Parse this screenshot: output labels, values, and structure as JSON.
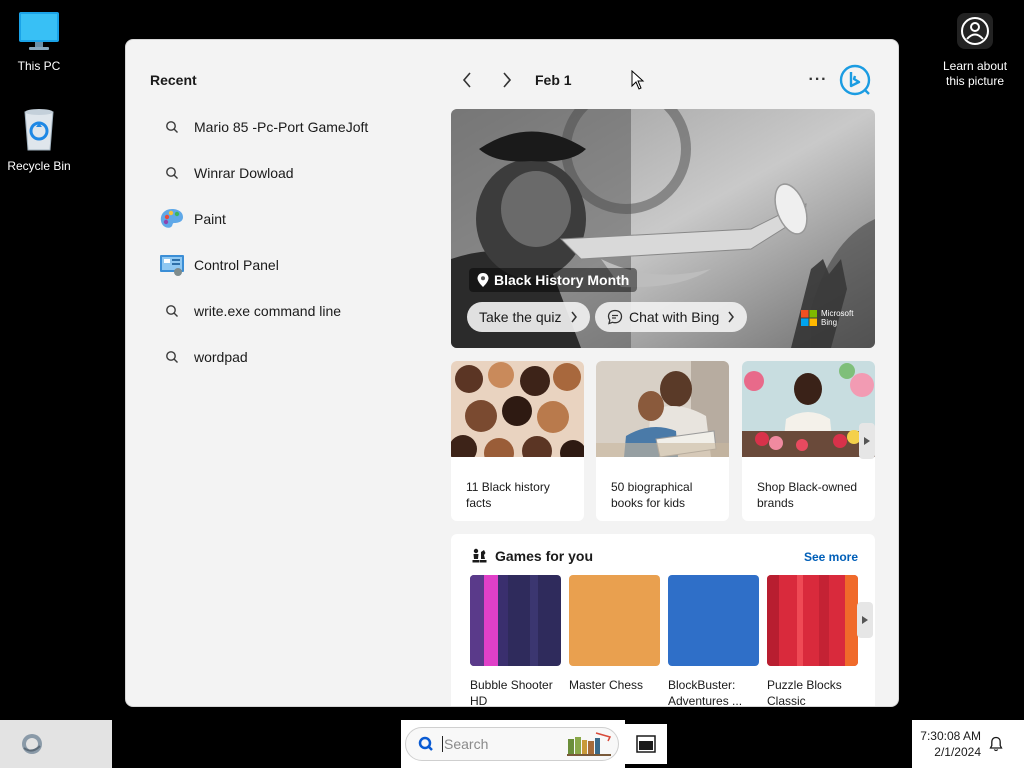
{
  "desktop": {
    "this_pc": "This PC",
    "recycle_bin": "Recycle Bin",
    "learn_line1": "Learn about",
    "learn_line2": "this picture"
  },
  "panel": {
    "recent_title": "Recent",
    "recent": [
      {
        "label": "Mario 85 -Pc-Port GameJoft",
        "icon": "search-icon"
      },
      {
        "label": "Winrar Dowload",
        "icon": "search-icon"
      },
      {
        "label": "Paint",
        "icon": "paint-icon"
      },
      {
        "label": "Control Panel",
        "icon": "control-panel-icon"
      },
      {
        "label": "write.exe command line",
        "icon": "search-icon"
      },
      {
        "label": "wordpad",
        "icon": "search-icon"
      }
    ],
    "date": "Feb 1",
    "more": "···",
    "hero": {
      "title": "Black History Month",
      "quiz": "Take the quiz",
      "chat": "Chat with Bing",
      "brand_line1": "Microsoft",
      "brand_line2": "Bing"
    },
    "cards": [
      {
        "line1": "11 Black history",
        "line2": "facts"
      },
      {
        "line1": "50 biographical",
        "line2": "books for kids"
      },
      {
        "line1": "Shop Black-owned",
        "line2": "brands"
      }
    ],
    "games": {
      "title": "Games for you",
      "see_more": "See more",
      "items": [
        {
          "line1": "Bubble Shooter",
          "line2": "HD"
        },
        {
          "line1": "Master Chess",
          "line2": ""
        },
        {
          "line1": "BlockBuster:",
          "line2": "Adventures ..."
        },
        {
          "line1": "Puzzle Blocks",
          "line2": "Classic"
        }
      ]
    }
  },
  "taskbar": {
    "search_placeholder": "Search",
    "time": "7:30:08 AM",
    "date": "2/1/2024"
  },
  "colors": {
    "accent": "#005fb8",
    "panel_bg": "#f3f3f3",
    "bing_blue": "#1b9ce2"
  }
}
